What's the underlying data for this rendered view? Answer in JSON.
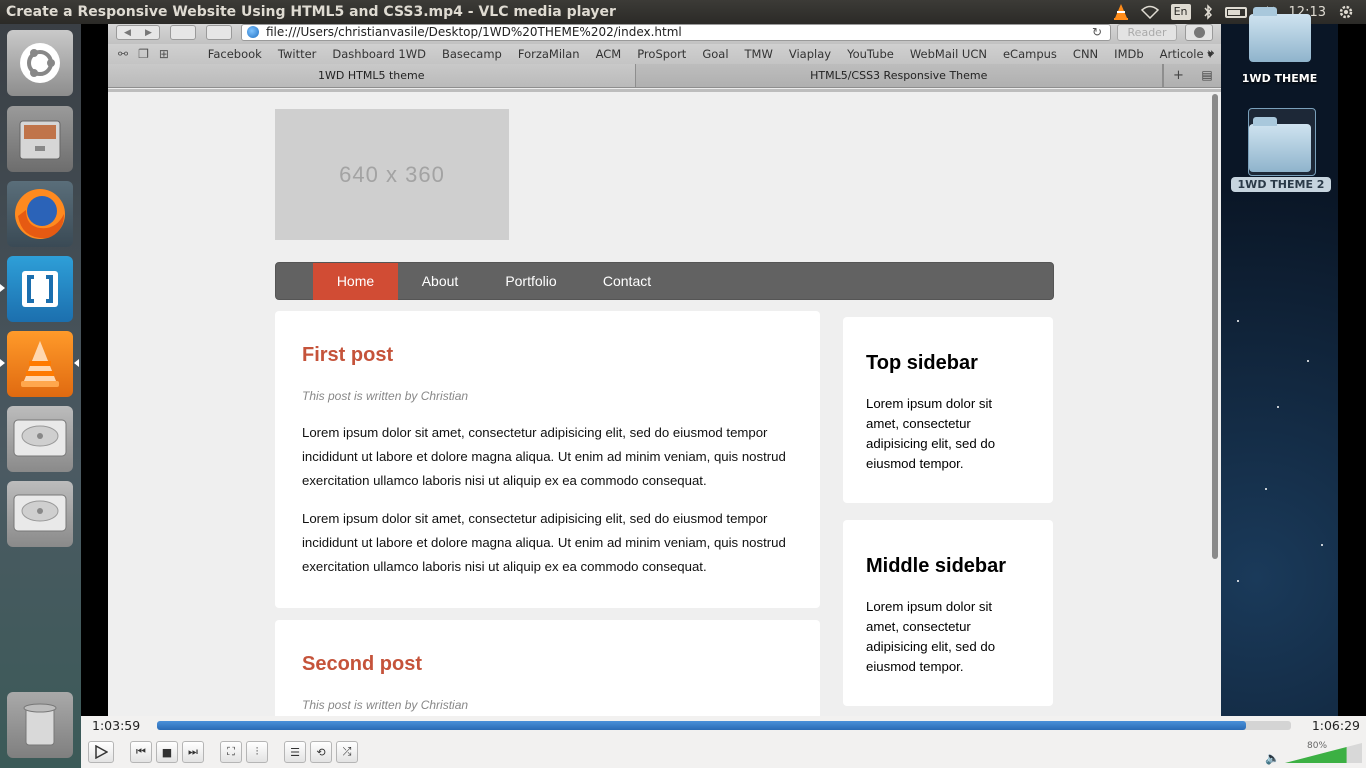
{
  "window": {
    "title": "Create a Responsive Website Using HTML5 and CSS3.mp4 - VLC media player"
  },
  "panel": {
    "language": "En",
    "clock": "12:13"
  },
  "browser": {
    "url": "file:///Users/christianvasile/Desktop/1WD%20THEME%202/index.html",
    "reader_label": "Reader",
    "bookmarks": [
      "Facebook",
      "Twitter",
      "Dashboard 1WD",
      "Basecamp",
      "ForzaMilan",
      "ACM",
      "ProSport",
      "Goal",
      "TMW",
      "Viaplay",
      "YouTube",
      "WebMail UCN",
      "eCampus",
      "CNN",
      "IMDb",
      "Articole ▾"
    ],
    "tabs": [
      "1WD HTML5 theme",
      "HTML5/CSS3 Responsive Theme"
    ]
  },
  "site": {
    "logo_placeholder": "640 x 360",
    "nav": [
      "Home",
      "About",
      "Portfolio",
      "Contact"
    ],
    "active_nav": "Home",
    "accent_color": "#d14c34",
    "posts": [
      {
        "title": "First post",
        "byline": "This post is written by Christian",
        "paragraphs": [
          "Lorem ipsum dolor sit amet, consectetur adipisicing elit, sed do eiusmod tempor incididunt ut labore et dolore magna aliqua. Ut enim ad minim veniam, quis nostrud exercitation ullamco laboris nisi ut aliquip ex ea commodo consequat.",
          "Lorem ipsum dolor sit amet, consectetur adipisicing elit, sed do eiusmod tempor incididunt ut labore et dolore magna aliqua. Ut enim ad minim veniam, quis nostrud exercitation ullamco laboris nisi ut aliquip ex ea commodo consequat."
        ]
      },
      {
        "title": "Second post",
        "byline": "This post is written by Christian"
      }
    ],
    "sidebars": [
      {
        "title": "Top sidebar",
        "text": "Lorem ipsum dolor sit amet, consectetur adipisicing elit, sed do eiusmod tempor."
      },
      {
        "title": "Middle sidebar",
        "text": "Lorem ipsum dolor sit amet, consectetur adipisicing elit, sed do eiusmod tempor."
      }
    ]
  },
  "desktop": {
    "icons": [
      "1WD THEME",
      "1WD THEME 2"
    ]
  },
  "player": {
    "elapsed": "1:03:59",
    "remaining": "1:06:29",
    "progress_fraction": 0.96,
    "volume_label": "80%",
    "volume_fraction": 0.8
  },
  "icons": [
    "ubuntu-icon",
    "files-icon",
    "firefox-icon",
    "brackets-icon",
    "vlc-icon",
    "disk-icon",
    "trash-icon",
    "wifi-icon",
    "bluetooth-icon",
    "battery-icon",
    "volume-icon",
    "gear-icon",
    "play-icon",
    "prev-icon",
    "stop-icon",
    "next-icon",
    "fullscreen-icon",
    "equalizer-icon",
    "playlist-icon",
    "loop-icon",
    "shuffle-icon"
  ]
}
